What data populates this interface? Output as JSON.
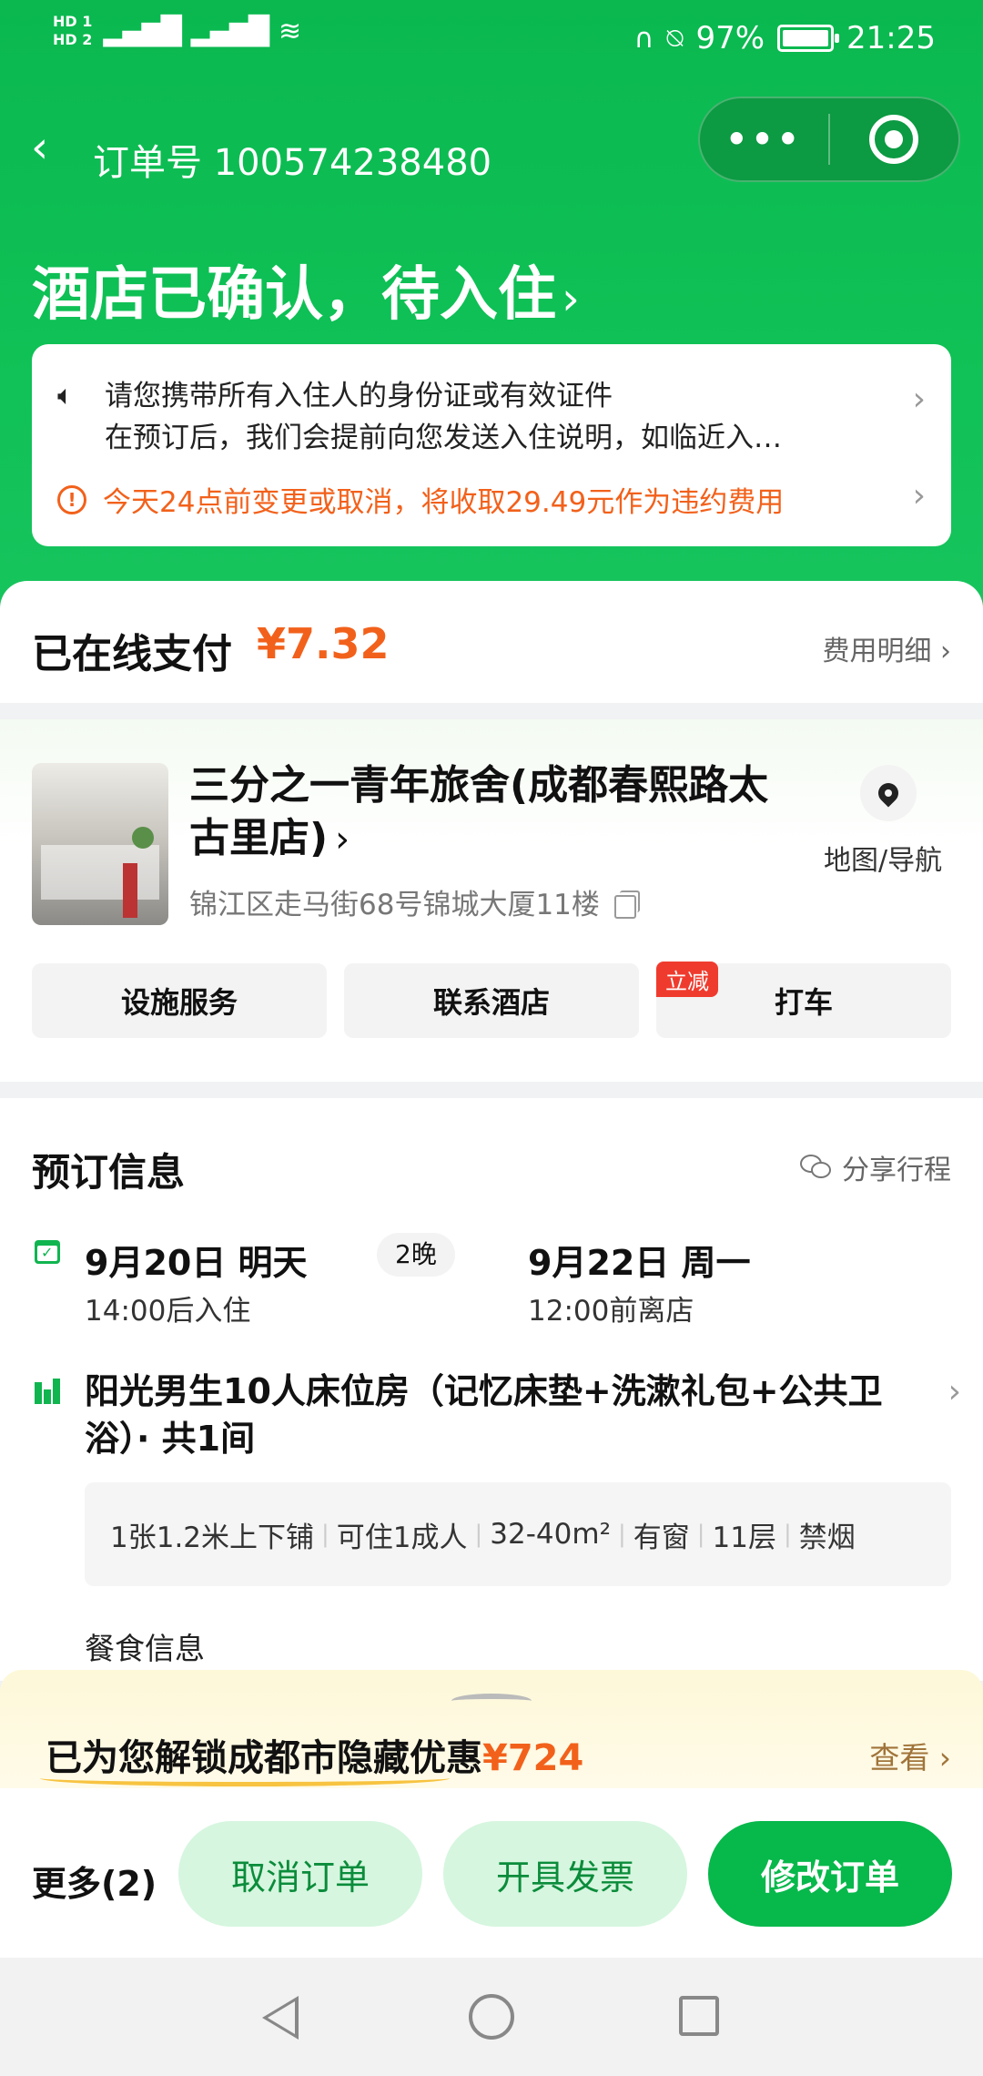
{
  "status_bar": {
    "hd1": "HD 1",
    "hd2": "HD 2",
    "signal": "4G 4G",
    "battery": "97%",
    "time": "21:25"
  },
  "nav": {
    "back_icon": "chevron-left",
    "order_number": "订单号 100574238480",
    "capsule_more": "•••",
    "capsule_close_icon": "target-circle"
  },
  "status": {
    "title": "酒店已确认，待入住",
    "chevron": "›"
  },
  "notice": {
    "line1": "请您携带所有入住人的身份证或有效证件",
    "line2": "在预订后，我们会提前向您发送入住说明，如临近入…",
    "warning": "今天24点前变更或取消，将收取29.49元作为违约费用"
  },
  "payment": {
    "label": "已在线支付",
    "amount": "¥7.32",
    "detail_link": "费用明细 ›"
  },
  "hotel": {
    "name": "三分之一青年旅舍(成都春熙路太古里店)",
    "address": "锦江区走马街68号锦城大厦11楼",
    "map_label": "地图/导航",
    "actions": [
      {
        "label": "设施服务"
      },
      {
        "label": "联系酒店"
      },
      {
        "label": "打车",
        "tag": "立减"
      }
    ]
  },
  "booking": {
    "title": "预订信息",
    "share": "分享行程",
    "checkin_date": "9月20日 明天",
    "checkin_time": "14:00后入住",
    "nights": "2晚",
    "checkout_date": "9月22日 周一",
    "checkout_time": "12:00前离店",
    "room": "阳光男生10人床位房（记忆床垫+洗漱礼包+公共卫浴）· 共1间",
    "specs": [
      "1张1.2米上下铺",
      "可住1成人",
      "32-40m²",
      "有窗",
      "11层",
      "禁烟"
    ],
    "meal": "餐食信息"
  },
  "promo": {
    "text": "已为您解锁成都市隐藏优惠",
    "price": "¥724",
    "view": "查看 ›"
  },
  "bottom_bar": {
    "more": "更多(2)",
    "cancel": "取消订单",
    "invoice": "开具发票",
    "modify": "修改订单"
  },
  "colors": {
    "primary_green": "#10c257",
    "orange": "#f2611b",
    "light_green": "#d6f6df"
  }
}
